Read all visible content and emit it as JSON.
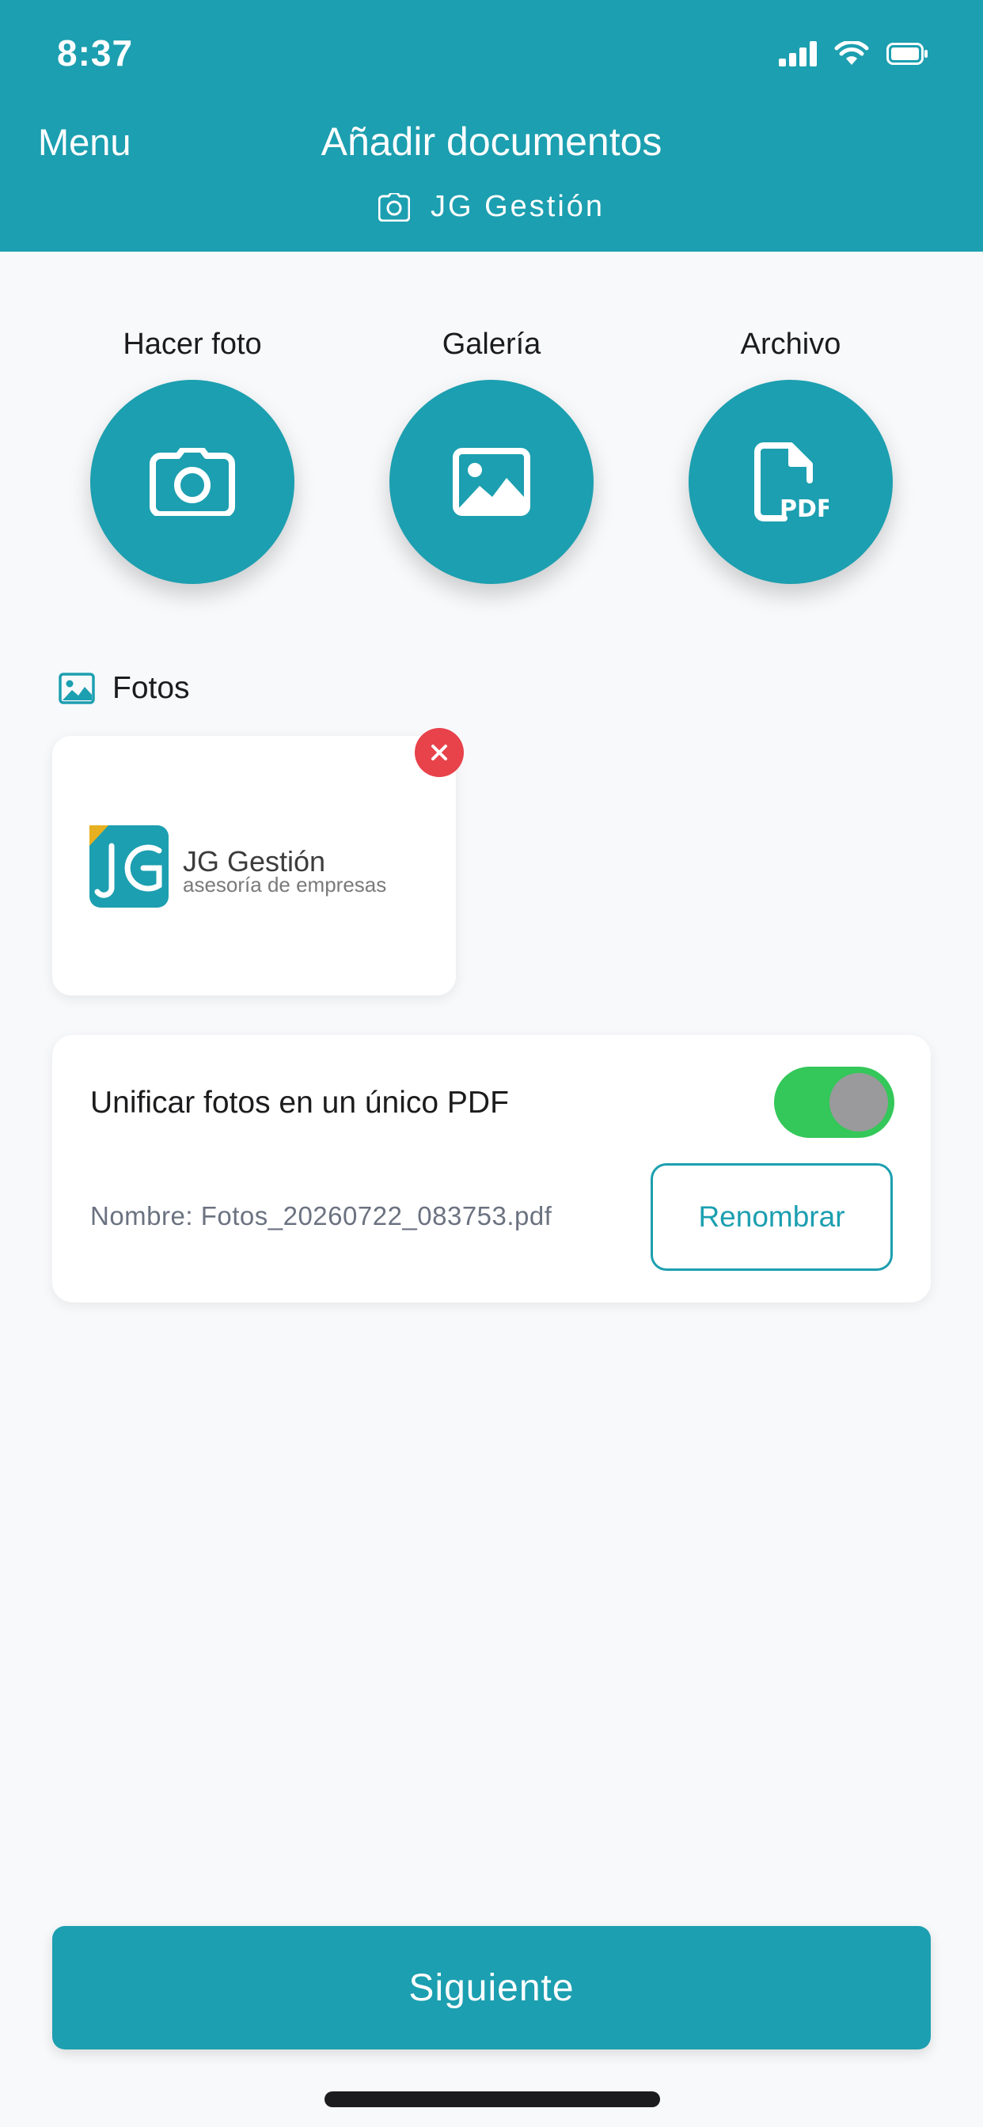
{
  "status_bar": {
    "time": "8:37"
  },
  "header": {
    "menu_label": "Menu",
    "title": "Añadir documentos",
    "subtitle": "JG Gestión"
  },
  "actions": [
    {
      "label": "Hacer foto",
      "icon": "camera-icon"
    },
    {
      "label": "Galería",
      "icon": "image-icon"
    },
    {
      "label": "Archivo",
      "icon": "pdf-file-icon"
    }
  ],
  "photos": {
    "section_title": "Fotos",
    "items": [
      {
        "logo_brand": "JG Gestión",
        "logo_tagline": "asesoría de empresas"
      }
    ]
  },
  "unify": {
    "label": "Unificar fotos en un único PDF",
    "toggle_on": true,
    "filename": "Nombre: Fotos_20260722_083753.pdf",
    "rename_label": "Renombrar"
  },
  "footer": {
    "next_label": "Siguiente"
  },
  "colors": {
    "accent": "#1c9fb0",
    "toggle_on": "#34c759",
    "danger": "#e8424b",
    "background": "#f8f9fb"
  }
}
